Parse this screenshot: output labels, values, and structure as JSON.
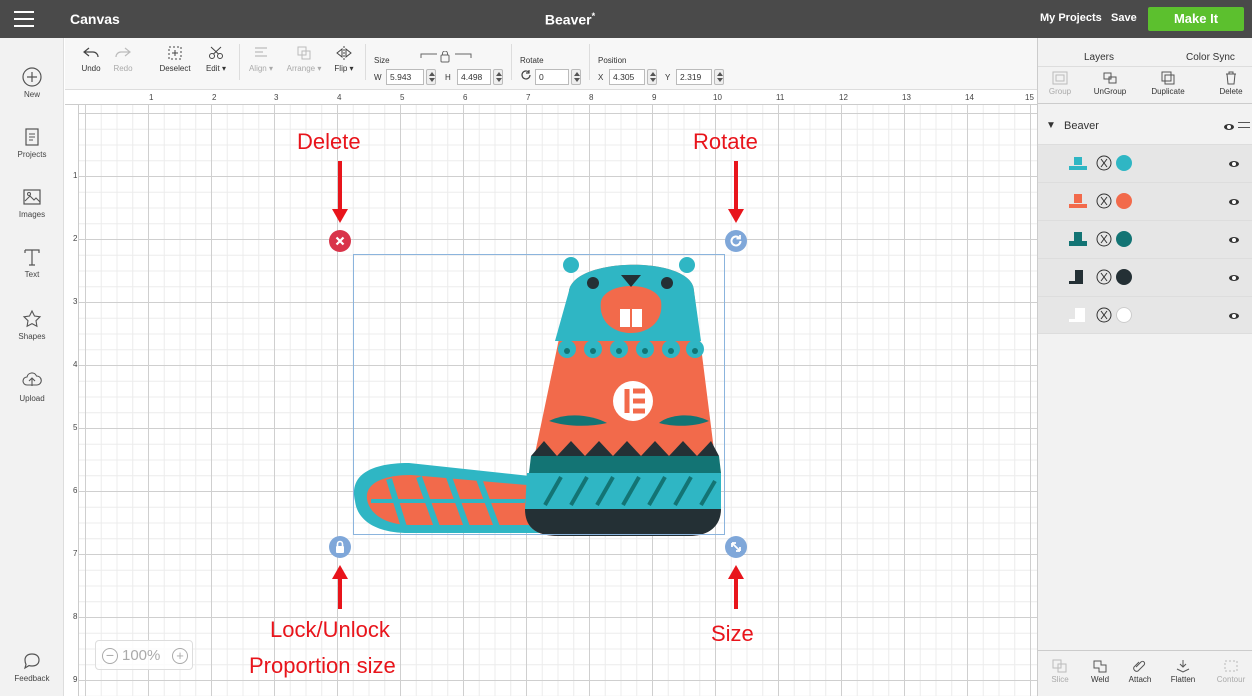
{
  "topbar": {
    "app_title": "Canvas",
    "project_title": "Beaver",
    "project_title_marker": "*",
    "my_projects": "My Projects",
    "save": "Save",
    "make_it": "Make It"
  },
  "sidebar": {
    "items": [
      {
        "label": "New",
        "icon": "plus-circle-icon"
      },
      {
        "label": "Projects",
        "icon": "projects-icon"
      },
      {
        "label": "Images",
        "icon": "images-icon"
      },
      {
        "label": "Text",
        "icon": "text-icon"
      },
      {
        "label": "Shapes",
        "icon": "shapes-icon"
      },
      {
        "label": "Upload",
        "icon": "upload-icon"
      }
    ],
    "feedback": "Feedback"
  },
  "toolbar": {
    "undo": "Undo",
    "redo": "Redo",
    "deselect": "Deselect",
    "edit": "Edit",
    "align": "Align",
    "arrange": "Arrange",
    "flip": "Flip",
    "size_label": "Size",
    "w_label": "W",
    "w_value": "5.943",
    "h_label": "H",
    "h_value": "4.498",
    "rotate_label": "Rotate",
    "rotate_value": "0",
    "position_label": "Position",
    "x_label": "X",
    "x_value": "4.305",
    "y_label": "Y",
    "y_value": "2.319"
  },
  "rulers": {
    "top": [
      "1",
      "2",
      "3",
      "4",
      "5",
      "6",
      "7",
      "8",
      "9",
      "10",
      "11",
      "12",
      "13",
      "14",
      "15"
    ],
    "left": [
      "1",
      "2",
      "3",
      "4",
      "5",
      "6",
      "7",
      "8",
      "9"
    ]
  },
  "zoom": {
    "value": "100%"
  },
  "annotations": {
    "delete": "Delete",
    "rotate": "Rotate",
    "lock_line1": "Lock/Unlock",
    "lock_line2": "Proportion size",
    "size": "Size"
  },
  "layers_panel": {
    "tab_layers": "Layers",
    "tab_color_sync": "Color Sync",
    "tools": [
      "Group",
      "UnGroup",
      "Duplicate",
      "Delete"
    ],
    "group_name": "Beaver",
    "layers": [
      {
        "color": "#2fb6c4"
      },
      {
        "color": "#f26a4b"
      },
      {
        "color": "#137474"
      },
      {
        "color": "#243035"
      },
      {
        "color": "#ffffff"
      }
    ],
    "bottom_tools": [
      "Slice",
      "Weld",
      "Attach",
      "Flatten",
      "Contour"
    ]
  },
  "colors": {
    "accent": "#5cc02e",
    "teal": "#2fb6c4",
    "orange": "#f26a4b",
    "dark_teal": "#137474",
    "charcoal": "#243035",
    "annotation_red": "#e8141b",
    "delete_handle": "#d9344a",
    "handle_blue": "#7fa7d9"
  }
}
